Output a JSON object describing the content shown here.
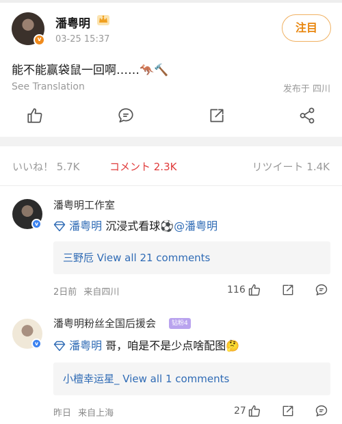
{
  "post": {
    "username": "潘粤明",
    "timestamp": "03-25 15:37",
    "follow_label": "注目",
    "text": "能不能赢袋鼠一回啊……",
    "emoji": "🦘🔨",
    "see_translation": "See Translation",
    "location": "发布于 四川",
    "verified_badge": "v"
  },
  "stats": {
    "likes": "いいね！ 5.7K",
    "comments": "コメント 2.3K",
    "reposts": "リツイート 1.4K"
  },
  "comments": [
    {
      "author": "潘粤明工作室",
      "mention_prefix": "潘粤明",
      "text": " 沉浸式看球",
      "emoji": "⚽",
      "mention_suffix": "@潘粤明",
      "replies_user": "三野卮",
      "replies_text": " View all 21 comments",
      "time": "2日前",
      "location": "来自四川",
      "like_count": "116"
    },
    {
      "author": "潘粤明粉丝全国后援会",
      "fan_badge": "钻粉4",
      "mention_prefix": "潘粤明",
      "text": " 哥，咱是不是少点啥配图",
      "emoji": "🤔",
      "replies_user": "小檀幸运星_",
      "replies_text": " View all 1 comments",
      "time": "昨日",
      "location": "来自上海",
      "like_count": "27"
    }
  ],
  "colors": {
    "accent_orange": "#e8850c",
    "active_tab_red": "#e03a3a",
    "link_blue": "#2f6bb5",
    "verified_blue": "#3b82f0",
    "verified_orange": "#f08a1c"
  },
  "icons": {
    "like": "thumbs-up-icon",
    "comment": "comment-bubble-icon",
    "repost": "share-out-icon",
    "share": "share-nodes-icon",
    "diamond": "diamond-icon",
    "crown": "crown-icon"
  }
}
